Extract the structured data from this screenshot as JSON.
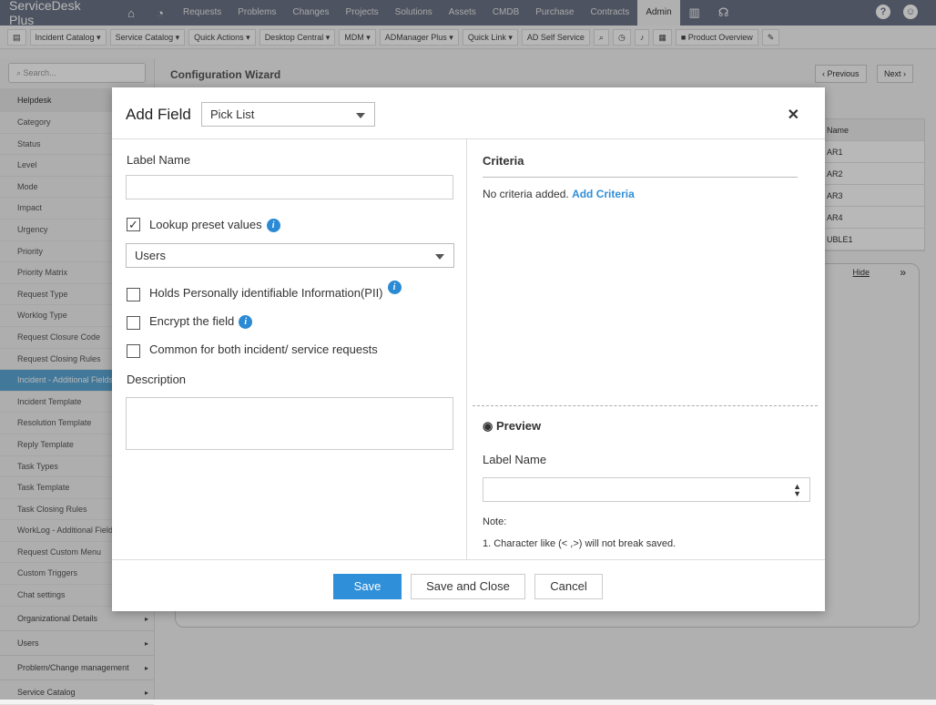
{
  "app": {
    "logo": "ServiceDesk Plus",
    "nav": [
      "Requests",
      "Problems",
      "Changes",
      "Projects",
      "Solutions",
      "Assets",
      "CMDB",
      "Purchase",
      "Contracts",
      "Admin"
    ],
    "active": "Admin"
  },
  "toolbar": [
    "Incident Catalog",
    "Service Catalog",
    "Quick Actions",
    "Desktop Central",
    "MDM",
    "ADManager Plus",
    "Quick Link",
    "AD Self Service"
  ],
  "toolbar_product": "Product Overview",
  "sidebar": {
    "search_placeholder": "Search...",
    "header": "Helpdesk",
    "items": [
      "Category",
      "Status",
      "Level",
      "Mode",
      "Impact",
      "Urgency",
      "Priority",
      "Priority Matrix",
      "Request Type",
      "Worklog Type",
      "Request Closure Code",
      "Request Closing Rules",
      "Incident - Additional Fields",
      "Incident Template",
      "Resolution Template",
      "Reply Template",
      "Task Types",
      "Task Template",
      "Task Closing Rules",
      "WorkLog - Additional Fields",
      "Request Custom Menu",
      "Custom Triggers",
      "Chat settings"
    ],
    "active_index": 12,
    "groups": [
      "Organizational Details",
      "Users",
      "Problem/Change management",
      "Service Catalog"
    ]
  },
  "main": {
    "title": "Configuration Wizard",
    "previous": "Previous",
    "next": "Next",
    "table_header": "Name",
    "rows": [
      "AR1",
      "AR2",
      "AR3",
      "AR4",
      "UBLE1"
    ],
    "hide": "Hide"
  },
  "modal": {
    "title": "Add Field",
    "type": "Pick List",
    "label_name": "Label Name",
    "label_value": "",
    "lookup": {
      "label": "Lookup preset values",
      "checked": true
    },
    "lookup_value": "Users",
    "pii": {
      "label": "Holds Personally identifiable Information(PII)",
      "checked": false
    },
    "encrypt": {
      "label": "Encrypt the field",
      "checked": false
    },
    "common": {
      "label": "Common for both incident/ service requests",
      "checked": false
    },
    "description": "Description",
    "criteria": {
      "title": "Criteria",
      "none": "No criteria added.",
      "add": "Add Criteria"
    },
    "preview": {
      "title": "Preview",
      "label": "Label Name",
      "note": "Note:",
      "note1": "1. Character like (< ,>) will not break saved."
    },
    "save": "Save",
    "save_close": "Save and Close",
    "cancel": "Cancel"
  },
  "colors": {
    "accent": "#2f8fd8",
    "header": "#6b7486",
    "active_sidebar": "#5ca8d6"
  }
}
